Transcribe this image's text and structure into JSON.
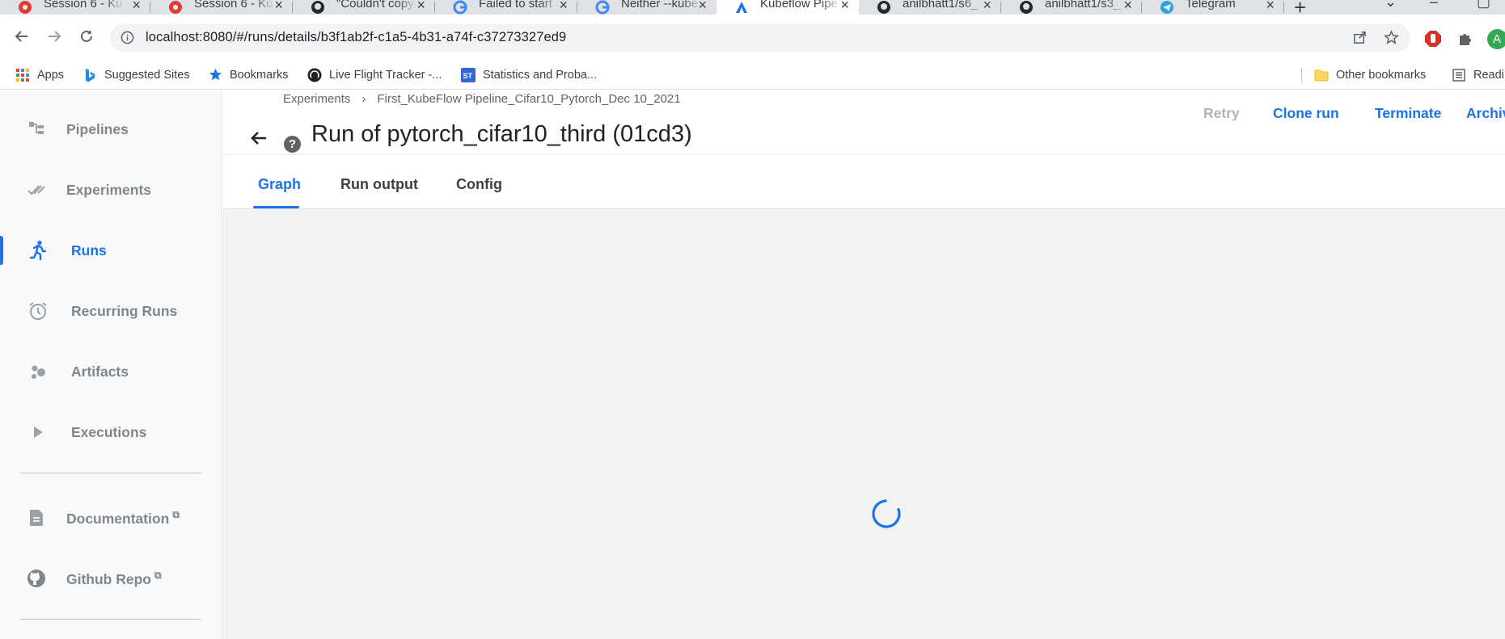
{
  "browser": {
    "tabs": [
      {
        "title": "Session 6 - Ku",
        "icon": "kubeflow-red-icon"
      },
      {
        "title": "Session 6 - Ku",
        "icon": "kubeflow-red-icon"
      },
      {
        "title": "\"Couldn't copy",
        "icon": "github-icon"
      },
      {
        "title": "Failed to start",
        "icon": "google-icon"
      },
      {
        "title": "Neither --kube",
        "icon": "google-icon"
      },
      {
        "title": "Kubeflow Pipe",
        "icon": "kubeflow-icon",
        "active": true
      },
      {
        "title": "anilbhatt1/s6_",
        "icon": "github-icon"
      },
      {
        "title": "anilbhatt1/s3_",
        "icon": "github-icon"
      },
      {
        "title": "Telegram",
        "icon": "telegram-icon"
      }
    ],
    "url": "localhost:8080/#/runs/details/b3f1ab2f-c1a5-4b31-a74f-c37273327ed9",
    "profile_initial": "A",
    "bookmarks": [
      {
        "label": "Apps",
        "icon": "apps-grid-icon"
      },
      {
        "label": "Suggested Sites",
        "icon": "bing-icon"
      },
      {
        "label": "Bookmarks",
        "icon": "star-icon"
      },
      {
        "label": "Live Flight Tracker -...",
        "icon": "flight-tracker-icon"
      },
      {
        "label": "Statistics and Proba...",
        "icon": "st-icon"
      }
    ],
    "other_bookmarks": "Other bookmarks",
    "reading_list": "Readi"
  },
  "sidebar": {
    "items": [
      {
        "label": "Pipelines",
        "icon": "pipelines-icon"
      },
      {
        "label": "Experiments",
        "icon": "experiments-icon"
      },
      {
        "label": "Runs",
        "icon": "runs-icon",
        "active": true
      },
      {
        "label": "Recurring Runs",
        "icon": "alarm-clock-icon"
      },
      {
        "label": "Artifacts",
        "icon": "artifacts-icon"
      },
      {
        "label": "Executions",
        "icon": "play-icon"
      }
    ],
    "links": [
      {
        "label": "Documentation",
        "icon": "document-icon"
      },
      {
        "label": "Github Repo",
        "icon": "github-icon"
      }
    ]
  },
  "main": {
    "breadcrumb": [
      "Experiments",
      "First_KubeFlow Pipeline_Cifar10_Pytorch_Dec 10_2021"
    ],
    "breadcrumb_sep": "›",
    "title": "Run of pytorch_cifar10_third (01cd3)",
    "help": "?",
    "actions": {
      "retry": "Retry",
      "clone": "Clone run",
      "terminate": "Terminate",
      "archive": "Archiv"
    },
    "tabs": [
      "Graph",
      "Run output",
      "Config"
    ],
    "active_tab": "Graph"
  },
  "colors": {
    "accent": "#1a73e8",
    "sidebar_bg": "#f8f9fa",
    "canvas_bg": "#f2f2f2"
  }
}
